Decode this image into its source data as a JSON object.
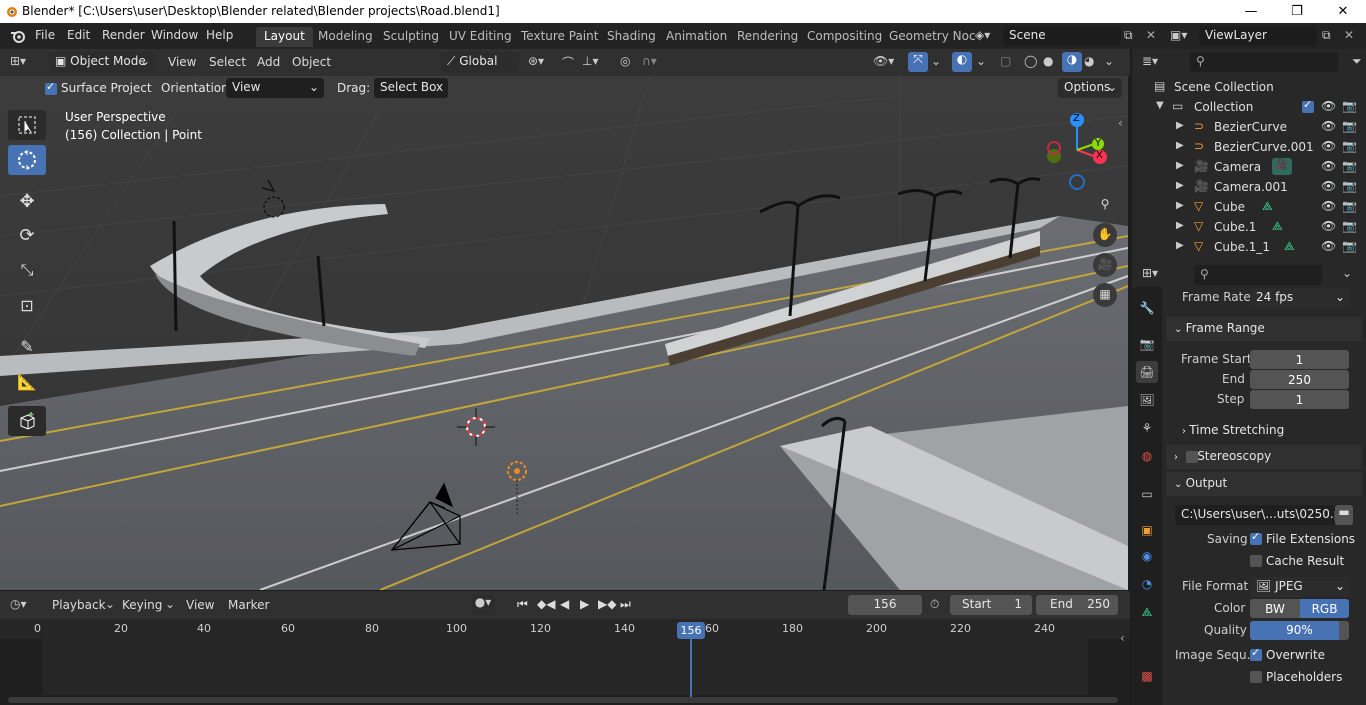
{
  "window": {
    "title": "Blender* [C:\\Users\\user\\Desktop\\Blender related\\Blender projects\\Road.blend1]"
  },
  "menu": {
    "file": "File",
    "edit": "Edit",
    "render": "Render",
    "window": "Window",
    "help": "Help"
  },
  "workspaces": [
    "Layout",
    "Modeling",
    "Sculpting",
    "UV Editing",
    "Texture Paint",
    "Shading",
    "Animation",
    "Rendering",
    "Compositing",
    "Geometry Noc"
  ],
  "scene": {
    "name": "Scene",
    "view_layer": "ViewLayer"
  },
  "viewport_header": {
    "mode": "Object Mode",
    "view": "View",
    "select": "Select",
    "add": "Add",
    "object": "Object",
    "orientation_global": "Global"
  },
  "tool_settings": {
    "surface_project": "Surface Project",
    "orientation_label": "Orientation:",
    "orientation_value": "View",
    "drag_label": "Drag:",
    "drag_value": "Select Box",
    "options": "Options"
  },
  "viewport": {
    "perspective": "User Perspective",
    "info": "(156) Collection | Point",
    "colors": {
      "x": "#ff3352",
      "y": "#8bdc00",
      "z": "#2890ff"
    },
    "gizmo": {
      "x": "X",
      "y": "Y",
      "z": "Z"
    }
  },
  "timeline": {
    "playback": "Playback",
    "keying": "Keying",
    "view": "View",
    "marker": "Marker",
    "current_frame": "156",
    "start_label": "Start",
    "start": "1",
    "end_label": "End",
    "end": "250",
    "ticks": [
      "0",
      "20",
      "40",
      "60",
      "80",
      "100",
      "120",
      "140",
      "160",
      "180",
      "200",
      "220",
      "240"
    ],
    "cursor_label": "156"
  },
  "outliner": {
    "root": "Scene Collection",
    "collection": "Collection",
    "items": [
      {
        "name": "BezierCurve",
        "icon": "curve-icon"
      },
      {
        "name": "BezierCurve.001",
        "icon": "curve-icon"
      },
      {
        "name": "Camera",
        "icon": "camera-icon"
      },
      {
        "name": "Camera.001",
        "icon": "camera-icon"
      },
      {
        "name": "Cube",
        "icon": "mesh-icon"
      },
      {
        "name": "Cube.1",
        "icon": "mesh-icon"
      },
      {
        "name": "Cube.1_1",
        "icon": "mesh-icon"
      }
    ]
  },
  "properties": {
    "frame_rate_label": "Frame Rate",
    "frame_rate": "24 fps",
    "frame_range": "Frame Range",
    "frame_start_label": "Frame Start",
    "frame_start": "1",
    "end_label": "End",
    "end": "250",
    "step_label": "Step",
    "step": "1",
    "time_stretching": "Time Stretching",
    "stereoscopy": "Stereoscopy",
    "output": "Output",
    "output_path": "C:\\Users\\user\\...uts\\0250.png",
    "saving_label": "Saving",
    "file_extensions": "File Extensions",
    "cache_result": "Cache Result",
    "file_format_label": "File Format",
    "file_format": "JPEG",
    "color_label": "Color",
    "bw": "BW",
    "rgb": "RGB",
    "quality_label": "Quality",
    "quality": "90%",
    "quality_fraction": 0.9,
    "image_sequence_label": "Image Sequ...",
    "overwrite": "Overwrite",
    "placeholders": "Placeholders"
  }
}
